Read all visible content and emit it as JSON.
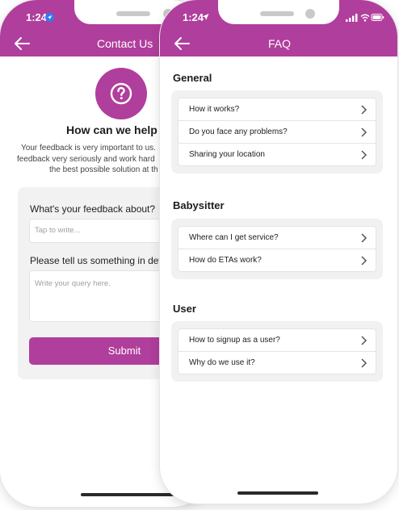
{
  "contact": {
    "time": "1:24",
    "title": "Contact Us",
    "heading": "How can we help y",
    "body_lines": [
      "Your feedback is very important to us.",
      "feedback very seriously and work hard",
      "the best possible solution at th"
    ],
    "feedback_label": "What's your feedback about?",
    "feedback_placeholder": "Tap to write...",
    "query_label": "Please tell us something in det",
    "query_placeholder": "Write your query here.",
    "submit_label": "Submit"
  },
  "faq": {
    "time": "1:24",
    "title": "FAQ",
    "sections": [
      {
        "title": "General",
        "items": [
          "How it works?",
          "Do you face any problems?",
          "Sharing your location"
        ]
      },
      {
        "title": "Babysitter",
        "items": [
          "Where can I get service?",
          "How do ETAs work?"
        ]
      },
      {
        "title": "User",
        "items": [
          "How to signup as a user?",
          "Why do we use it?"
        ]
      }
    ]
  },
  "colors": {
    "accent": "#b03e9c",
    "card_bg": "#f1f1f1"
  },
  "icons": [
    "back-arrow-icon",
    "location-arrow-icon",
    "question-mark-icon",
    "chevron-right-icon",
    "wifi-icon",
    "battery-icon"
  ]
}
